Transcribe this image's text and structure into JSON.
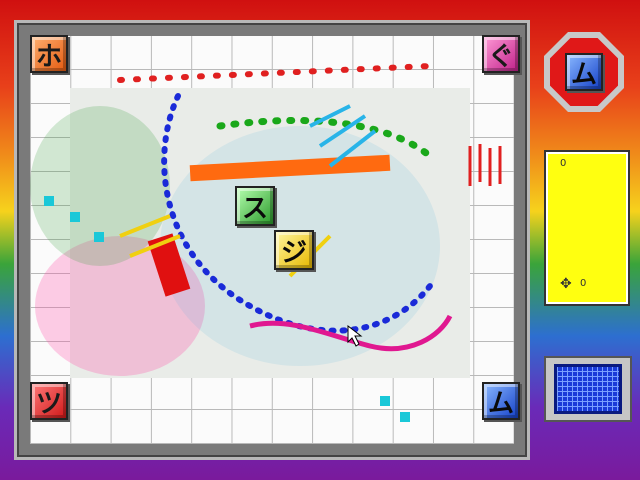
{
  "board": {
    "corner_tiles": {
      "top_left": {
        "char": "ホ",
        "color": "orange"
      },
      "top_right": {
        "char": "ぐ",
        "color": "magenta"
      },
      "bottom_left": {
        "char": "ツ",
        "color": "red"
      },
      "bottom_right": {
        "char": "ム",
        "color": "blue"
      }
    },
    "center_tiles": [
      {
        "char": "ス",
        "color": "green"
      },
      {
        "char": "ジ",
        "color": "yellow"
      }
    ]
  },
  "sidebar": {
    "current_tile": {
      "char": "ム",
      "color": "blue"
    },
    "score_panel": {
      "top_mark": "0",
      "bottom_mark": "0",
      "icon": "crosshair-icon"
    }
  },
  "colors": {
    "panel_yellow": "#ffff10",
    "badge_red": "#e01818",
    "grid_blue": "#1a3ad8"
  }
}
